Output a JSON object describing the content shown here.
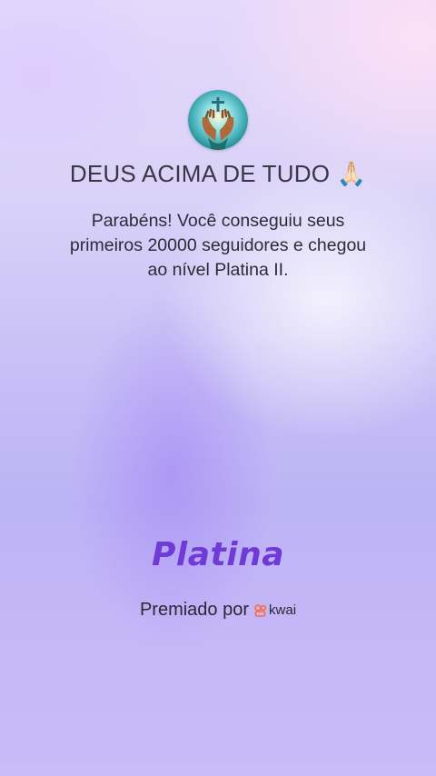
{
  "profile": {
    "name": "DEUS ACIMA DE TUDO",
    "emoji": "🙏🏻"
  },
  "message": "Parabéns! Você conseguiu seus primeiros 20000 seguidores e chegou ao nível Platina II.",
  "level": "Platina",
  "awarded_by": {
    "label": "Premiado por",
    "brand": "kwai",
    "brand_icon": "kwai-logo-icon"
  },
  "colors": {
    "level_text": "#6f3ad6",
    "brand_icon": "#ff6a3d"
  }
}
